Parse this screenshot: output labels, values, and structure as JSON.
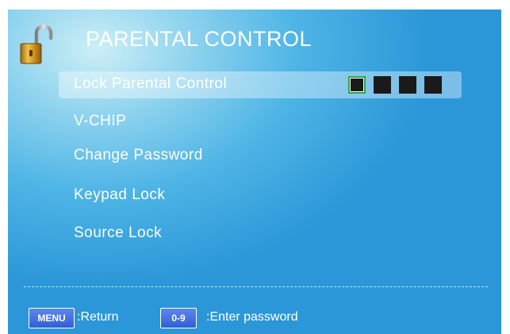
{
  "header": {
    "title": "PARENTAL CONTROL",
    "icon": "padlock-open-icon"
  },
  "menu": {
    "items": [
      {
        "label": "Lock Parental Control",
        "selected": true
      },
      {
        "label": "V-CHIP",
        "selected": false
      },
      {
        "label": "Change Password",
        "selected": false
      },
      {
        "label": "Keypad Lock",
        "selected": false
      },
      {
        "label": "Source Lock",
        "selected": false
      }
    ]
  },
  "password": {
    "digit_count": 4,
    "active_index": 0
  },
  "footer": {
    "menu_key": "MENU",
    "menu_action": ":Return",
    "digits_key": "0-9",
    "digits_action": ":Enter password"
  },
  "colors": {
    "background_top": "#cdeff7",
    "background_bottom": "#2b97d8",
    "highlight": "#ffffff",
    "pin_box": "#1a1a1a",
    "pin_focus": "#2fa24a",
    "key_button": "#3b6ee0"
  }
}
